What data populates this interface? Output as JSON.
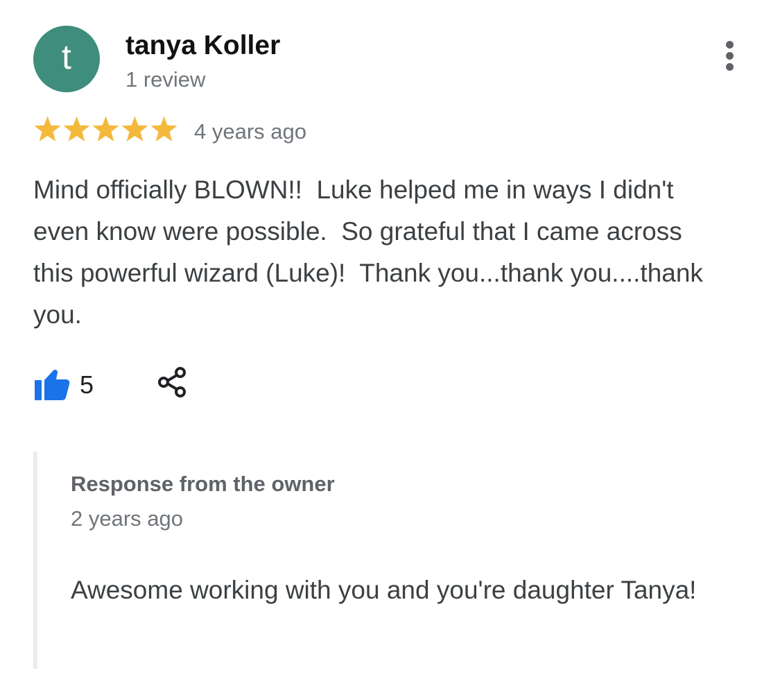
{
  "reviewer": {
    "avatar_initial": "t",
    "avatar_color": "#3f8d7c",
    "name": "tanya Koller",
    "review_count": "1 review"
  },
  "menu": {
    "icon": "more-vert-icon"
  },
  "review": {
    "rating": 5,
    "max_rating": 5,
    "star_color": "#f4b93c",
    "date": "4 years ago",
    "text": "Mind officially BLOWN!!  Luke helped me in ways I didn't even know were possible.  So grateful that I came across this powerful wizard (Luke)!  Thank you...thank you....thank you."
  },
  "actions": {
    "like_icon": "thumbs-up-icon",
    "like_color": "#1a73e8",
    "like_count": "5",
    "share_icon": "share-icon"
  },
  "owner_response": {
    "title": "Response from the owner",
    "date": "2 years ago",
    "text": "Awesome working with you and you're daughter Tanya!"
  }
}
